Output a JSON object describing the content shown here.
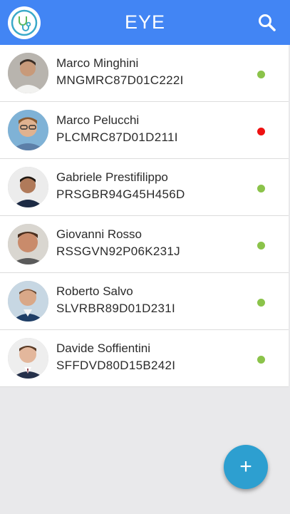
{
  "app": {
    "title": "EYE",
    "logo_icon": "stethoscope-logo-icon",
    "search_icon": "search-icon"
  },
  "colors": {
    "appbar": "#4285f4",
    "online": "#8bc34a",
    "offline": "#ee1111",
    "fab": "#2d9fd0"
  },
  "patients": [
    {
      "name": "Marco Minghini",
      "code": "MNGMRC87D01C222I",
      "status": "online"
    },
    {
      "name": "Marco Pelucchi",
      "code": "PLCMRC87D01D211I",
      "status": "offline"
    },
    {
      "name": "Gabriele Prestifilippo",
      "code": "PRSGBR94G45H456D",
      "status": "online"
    },
    {
      "name": "Giovanni Rosso",
      "code": "RSSGVN92P06K231J",
      "status": "online"
    },
    {
      "name": "Roberto Salvo",
      "code": "SLVRBR89D01D231I",
      "status": "online"
    },
    {
      "name": "Davide Soffientini",
      "code": "SFFDVD80D15B242I",
      "status": "online"
    }
  ],
  "fab": {
    "label": "+",
    "icon": "plus-icon"
  }
}
